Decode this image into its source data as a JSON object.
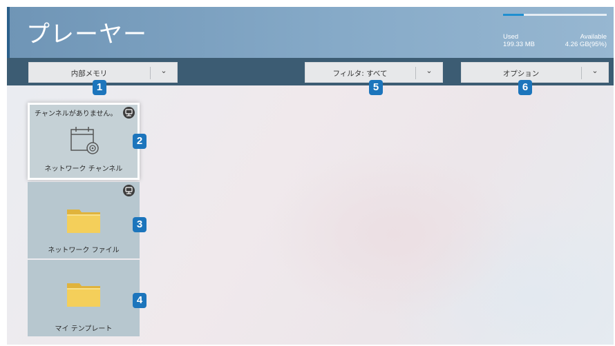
{
  "header": {
    "title": "プレーヤー",
    "storage": {
      "used_label": "Used",
      "used_value": "199.33 MB",
      "available_label": "Available",
      "available_value": "4.26 GB(95%)",
      "used_fraction": 0.05
    }
  },
  "toolbar": {
    "storage_select": {
      "label": "内部メモリ",
      "badge": "1"
    },
    "filter_select": {
      "label": "フィルタ: すべて",
      "badge": "5"
    },
    "options_select": {
      "label": "オプション",
      "badge": "6"
    }
  },
  "tiles": [
    {
      "label": "ネットワーク チャンネル",
      "note": "チャンネルがありません。",
      "badge": "2",
      "icon": "calendar-network-icon"
    },
    {
      "label": "ネットワーク ファイル",
      "badge": "3",
      "icon": "folder-icon"
    },
    {
      "label": "マイ テンプレート",
      "badge": "4",
      "icon": "folder-icon"
    }
  ],
  "colors": {
    "header": "#86aac8",
    "toolbar": "#3c5c73",
    "badge": "#1c75bc",
    "folder": "#f2c94c"
  }
}
